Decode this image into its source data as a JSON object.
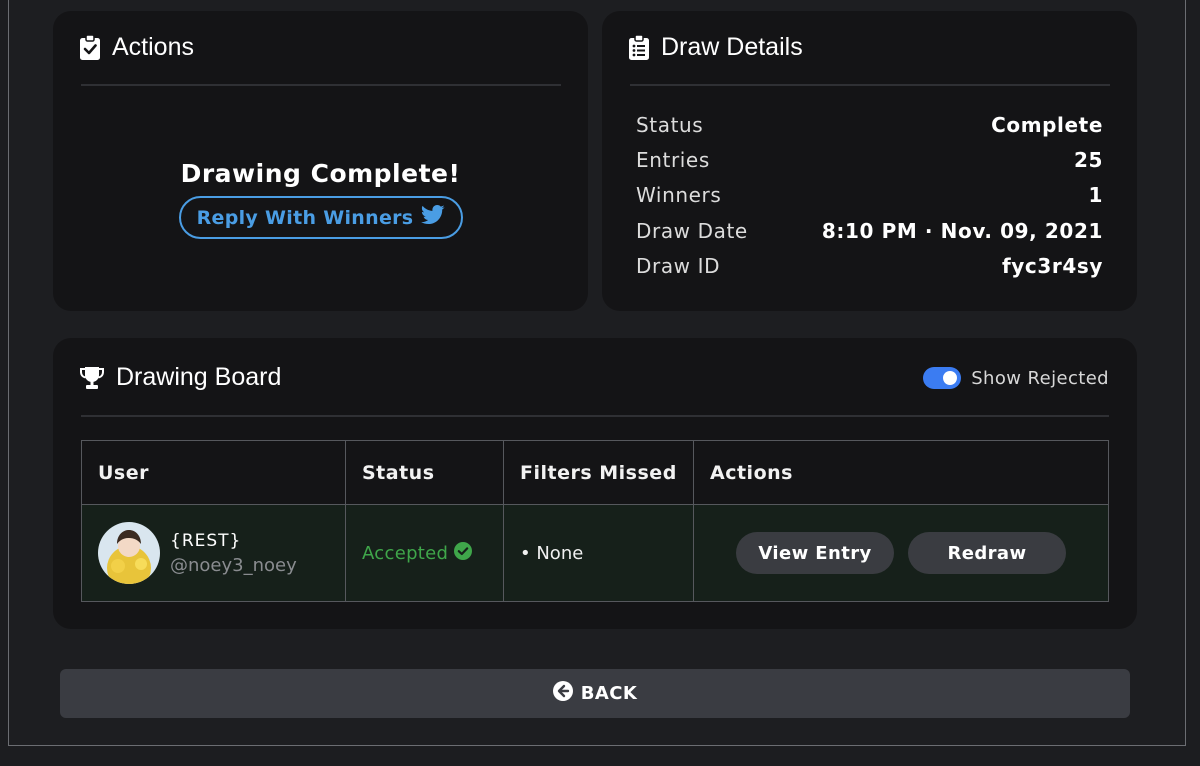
{
  "actions_card": {
    "title": "Actions",
    "complete_text": "Drawing Complete!",
    "reply_label": "Reply With Winners"
  },
  "details_card": {
    "title": "Draw Details",
    "rows": [
      {
        "label": "Status",
        "value": "Complete"
      },
      {
        "label": "Entries",
        "value": "25"
      },
      {
        "label": "Winners",
        "value": "1"
      },
      {
        "label": "Draw Date",
        "value": "8:10 PM · Nov. 09, 2021"
      },
      {
        "label": "Draw ID",
        "value": "fyc3r4sy"
      }
    ]
  },
  "board_card": {
    "title": "Drawing Board",
    "toggle_label": "Show Rejected",
    "toggle_on": true,
    "columns": [
      "User",
      "Status",
      "Filters Missed",
      "Actions"
    ],
    "rows": [
      {
        "user_name": "{REST}",
        "user_handle": "@noey3_noey",
        "status": "Accepted",
        "filters_missed": "• None",
        "view_label": "View Entry",
        "redraw_label": "Redraw"
      }
    ]
  },
  "back_label": "BACK",
  "colors": {
    "accent_blue": "#4a9de4",
    "toggle_blue": "#3b7cf2",
    "accepted_green": "#3fa64a",
    "card_bg": "#141416",
    "page_bg": "#1d1e21"
  }
}
